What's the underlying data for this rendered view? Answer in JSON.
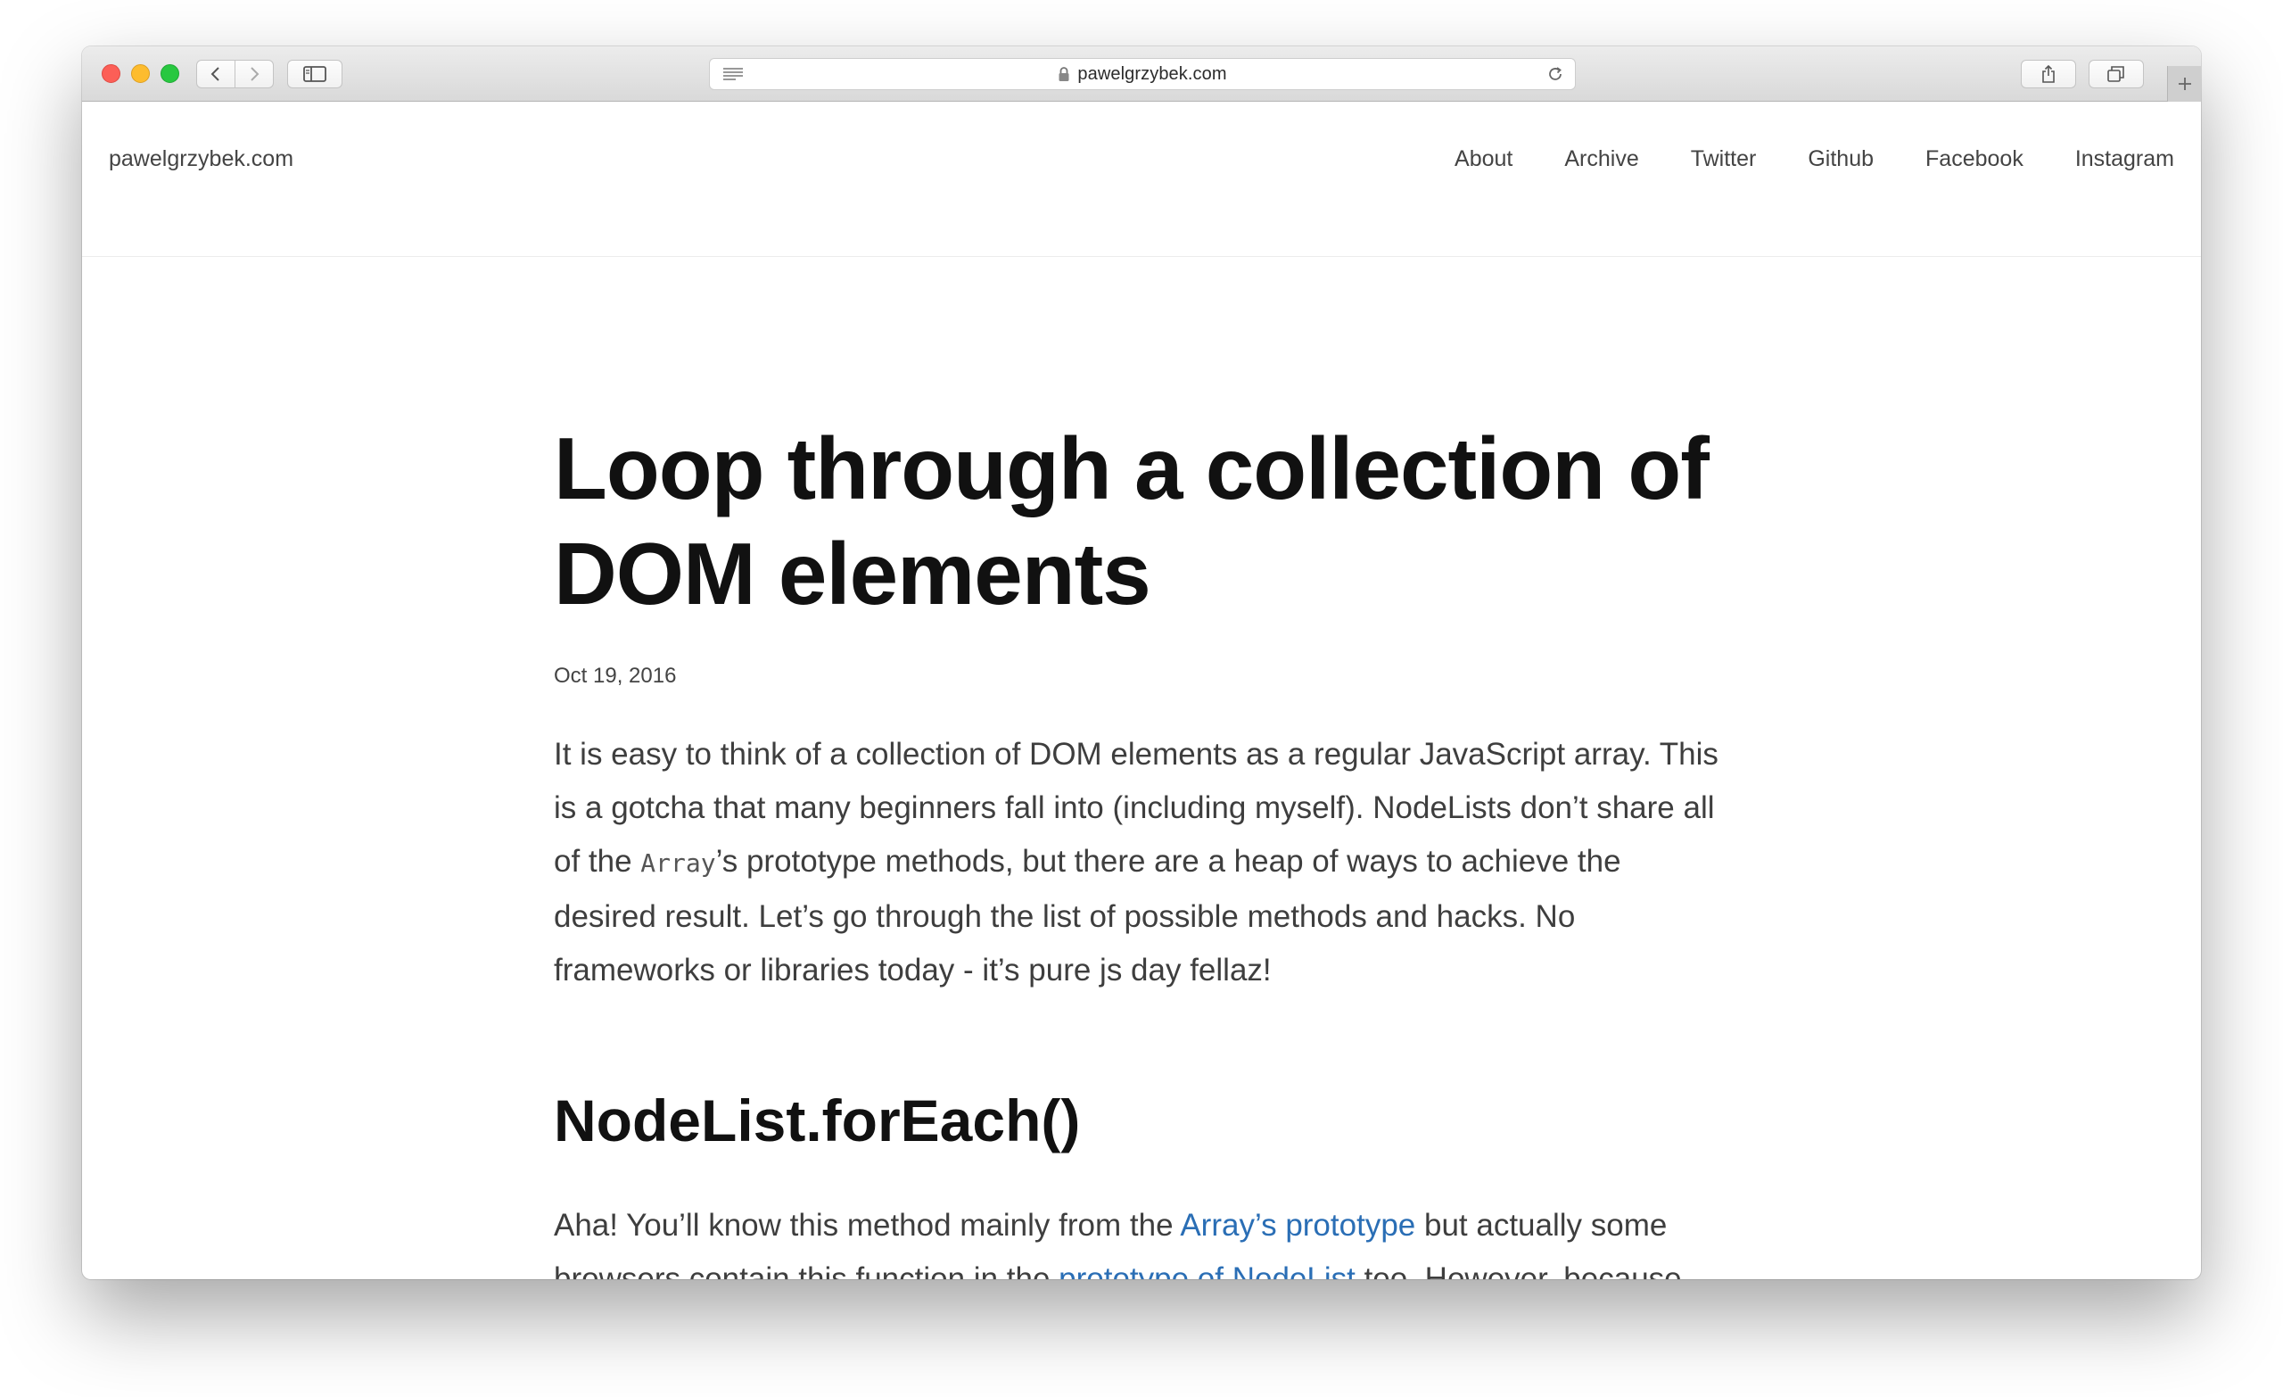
{
  "browser": {
    "url": "pawelgrzybek.com",
    "icons": {
      "close": "close-button-red",
      "minimize": "minimize-button-yellow",
      "zoom": "zoom-button-green",
      "back": "chevron-left-icon",
      "forward": "chevron-right-icon",
      "sidebar": "sidebar-icon",
      "reader": "reader-lines-icon",
      "lock": "lock-icon",
      "reload": "reload-icon",
      "share": "share-icon",
      "tabs": "tabs-overview-icon",
      "new_tab": "plus-icon"
    }
  },
  "site": {
    "title": "pawelgrzybek.com",
    "nav": [
      "About",
      "Archive",
      "Twitter",
      "Github",
      "Facebook",
      "Instagram"
    ]
  },
  "post": {
    "title": "Loop through a collection of DOM elements",
    "date": "Oct 19, 2016",
    "intro": {
      "before_code": "It is easy to think of a collection of DOM elements as a regular JavaScript array. This is a gotcha that many beginners fall into (including myself). NodeLists don’t share all of the ",
      "code": "Array",
      "after_code": "’s prototype methods, but there are a heap of ways to achieve the desired result. Let’s go through the list of possible methods and hacks. No frameworks or libraries today - it’s pure js day fellaz!"
    },
    "section_heading": "NodeList.forEach()",
    "para2": {
      "text1": "Aha! You’ll know this method mainly from the ",
      "link1": "Array’s prototype",
      "text2": " but actually some browsers contain this function in the ",
      "link2": "prototype of NodeList",
      "text3": " too. However, because"
    }
  },
  "colors": {
    "link": "#2a6eb5",
    "heading": "#111111",
    "body_text": "#3e3e3e"
  }
}
